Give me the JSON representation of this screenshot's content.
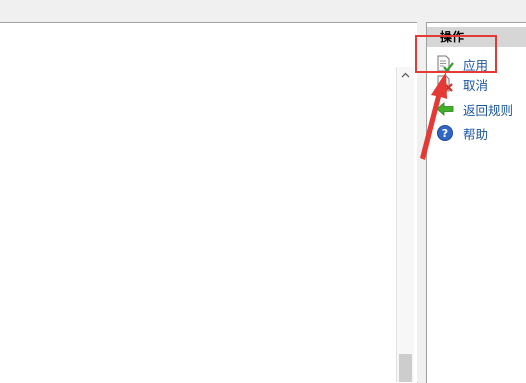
{
  "actions": {
    "header": "操作",
    "items": [
      {
        "label": "应用",
        "icon": "apply-document-icon"
      },
      {
        "label": "取消",
        "icon": "cancel-document-icon"
      },
      {
        "label": "返回规则",
        "icon": "back-arrow-icon"
      },
      {
        "label": "帮助",
        "icon": "help-icon"
      }
    ]
  },
  "scrollbar": {
    "up_icon": "chevron-up-icon"
  },
  "annotation": {
    "color": "#e53935"
  },
  "colors": {
    "link": "#1a56a0",
    "header_bg": "#d6d6d6"
  }
}
